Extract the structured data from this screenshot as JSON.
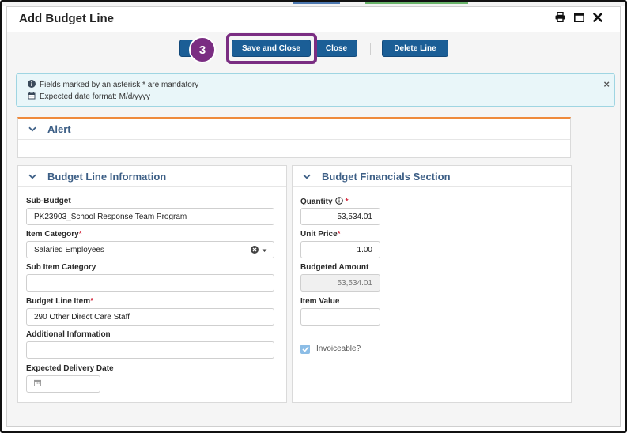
{
  "window": {
    "title": "Add Budget Line"
  },
  "toolbar": {
    "save_close_label": "Save and Close",
    "close_label": "Close",
    "delete_line_label": "Delete Line",
    "step_number": "3"
  },
  "info": {
    "mandatory_text": "Fields marked by an asterisk * are mandatory",
    "date_format_text": "Expected date format: M/d/yyyy",
    "dismiss_glyph": "×"
  },
  "alert_panel": {
    "title": "Alert"
  },
  "budget_line_info": {
    "title": "Budget Line Information",
    "sub_budget": {
      "label": "Sub-Budget",
      "value": "PK23903_School Response Team Program"
    },
    "item_category": {
      "label": "Item Category",
      "value": "Salaried Employees",
      "required_mark": "*"
    },
    "sub_item_category": {
      "label": "Sub Item Category",
      "value": ""
    },
    "budget_line_item": {
      "label": "Budget Line Item",
      "value": "290 Other Direct Care Staff",
      "required_mark": "*"
    },
    "additional_information": {
      "label": "Additional Information",
      "value": ""
    },
    "expected_delivery_date": {
      "label": "Expected Delivery Date",
      "value": ""
    }
  },
  "financials": {
    "title": "Budget Financials Section",
    "quantity": {
      "label": "Quantity",
      "value": "53,534.01",
      "required_mark": "*"
    },
    "unit_price": {
      "label": "Unit Price",
      "value": "1.00",
      "required_mark": "*"
    },
    "budgeted_amount": {
      "label": "Budgeted Amount",
      "value": "53,534.01"
    },
    "item_value": {
      "label": "Item Value",
      "value": ""
    },
    "invoiceable": {
      "label": "Invoiceable?",
      "checked": true
    }
  },
  "colors": {
    "primary_button": "#1b5e96",
    "highlight": "#7a2d82",
    "panel_title": "#3d5f86",
    "alert_accent": "#ef8a3c",
    "info_background": "#e9f6f9"
  },
  "icons": [
    "print-icon",
    "maximize-icon",
    "close-icon",
    "info-circle-icon",
    "calendar-icon",
    "chevron-down-icon",
    "clear-circle-icon",
    "caret-down-icon",
    "checkmark-icon"
  ]
}
